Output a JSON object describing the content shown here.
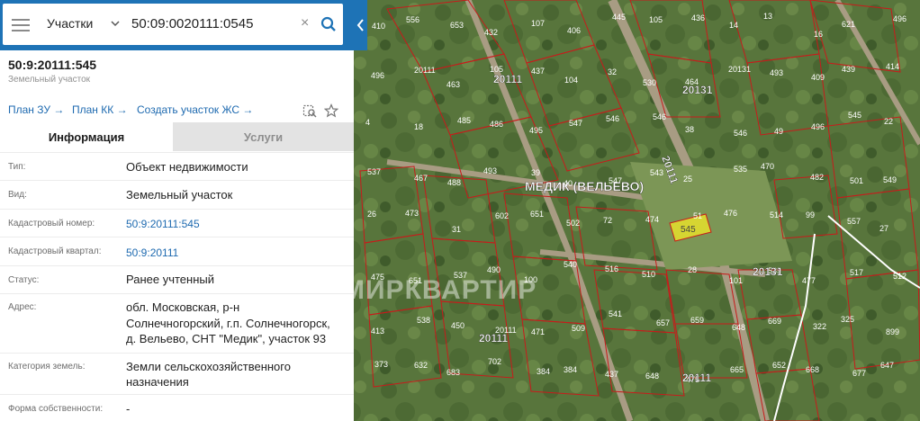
{
  "search": {
    "layer": "Участки",
    "query": "50:09:0020111:0545",
    "clear_glyph": "×"
  },
  "parcel": {
    "title": "50:9:20111:545",
    "subtitle": "Земельный участок"
  },
  "actions": {
    "plan_zu": "План ЗУ →",
    "plan_kk": "План КК →",
    "create": "Создать участок ЖС →"
  },
  "tabs": {
    "info": "Информация",
    "services": "Услуги"
  },
  "rows": [
    {
      "label": "Тип:",
      "value": "Объект недвижимости"
    },
    {
      "label": "Вид:",
      "value": "Земельный участок"
    },
    {
      "label": "Кадастровый номер:",
      "value": "50:9:20111:545"
    },
    {
      "label": "Кадастровый квартал:",
      "value": "50:9:20111"
    },
    {
      "label": "Статус:",
      "value": "Ранее учтенный"
    },
    {
      "label": "Адрес:",
      "value_lines": [
        "обл. Московская, р-н",
        "Солнечногорский, г.п. Солнечногорск,",
        "д. Вельево, СНТ \"Медик\", участок 93"
      ]
    },
    {
      "label": "Категория земель:",
      "value_lines": [
        "Земли сельскохозяйственного",
        "назначения"
      ]
    },
    {
      "label": "Форма собственности:",
      "value": "-"
    }
  ],
  "map": {
    "place_label": "МЕДИК (ВЕЛЬЕВО)",
    "watermark": "МИРКВАРТИР",
    "quarters": [
      "20111",
      "20131",
      "20131",
      "20111",
      "20111",
      "20111",
      "20111"
    ],
    "selected_parcel": "545",
    "parcel_numbers": [
      "410",
      "556",
      "653",
      "432",
      "107",
      "406",
      "445",
      "105",
      "436",
      "14",
      "13",
      "16",
      "621",
      "496",
      "496",
      "20111",
      "463",
      "105",
      "437",
      "104",
      "32",
      "530",
      "464",
      "20131",
      "493",
      "409",
      "439",
      "414",
      "4",
      "18",
      "485",
      "486",
      "495",
      "547",
      "546",
      "546",
      "38",
      "546",
      "49",
      "496",
      "545",
      "22",
      "537",
      "467",
      "488",
      "493",
      "39",
      "40",
      "547",
      "543",
      "25",
      "535",
      "470",
      "482",
      "501",
      "549",
      "26",
      "473",
      "31",
      "602",
      "651",
      "502",
      "72",
      "474",
      "51",
      "476",
      "514",
      "99",
      "557",
      "27",
      "475",
      "651",
      "537",
      "490",
      "100",
      "540",
      "516",
      "510",
      "28",
      "101",
      "539",
      "477",
      "517",
      "512",
      "413",
      "538",
      "450",
      "20111",
      "471",
      "509",
      "541",
      "657",
      "659",
      "648",
      "669",
      "322",
      "325",
      "899",
      "373",
      "632",
      "683",
      "702",
      "384",
      "384",
      "437",
      "648",
      "475",
      "665",
      "652",
      "668",
      "677",
      "647"
    ],
    "road_labels": [
      "20111",
      "20131"
    ]
  },
  "colors": {
    "accent": "#1e73b6",
    "link": "#1e6ab0",
    "parcel_border": "#c81b1b",
    "selected_parcel_fill": "#e6e02c"
  }
}
